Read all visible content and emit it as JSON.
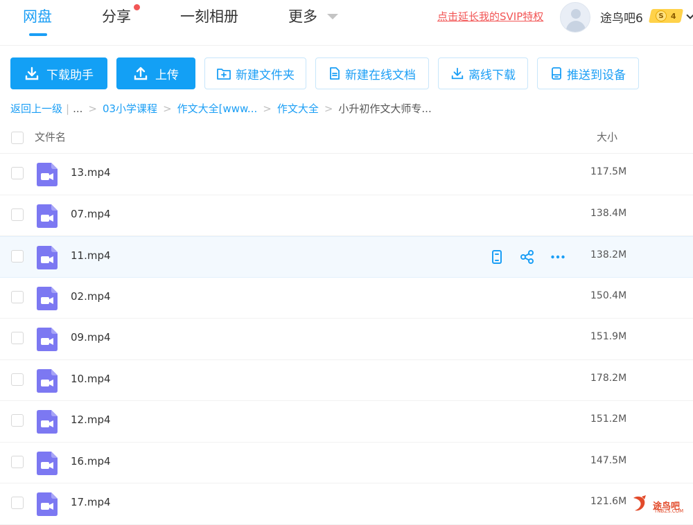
{
  "nav": {
    "items": [
      {
        "label": "网盘",
        "active": true
      },
      {
        "label": "分享"
      },
      {
        "label": "一刻相册"
      },
      {
        "label": "更多"
      }
    ],
    "accent": "#1a9ef5",
    "svip_link": "点击延长我的SVIP特权",
    "username": "途鸟吧6",
    "vip_level": "4",
    "vip_letter": "S"
  },
  "toolbar": {
    "download_helper": "下载助手",
    "upload": "上传",
    "new_folder": "新建文件夹",
    "new_online_doc": "新建在线文档",
    "offline_download": "离线下载",
    "push_to_device": "推送到设备"
  },
  "breadcrumb": {
    "back": "返回上一级",
    "ellipsis": "...",
    "items": [
      "03小学课程",
      "作文大全[www...",
      "作文大全"
    ],
    "current": "小升初作文大师专..."
  },
  "table": {
    "col_name": "文件名",
    "col_size": "大小",
    "rows": [
      {
        "name": "13.mp4",
        "size": "117.5M"
      },
      {
        "name": "07.mp4",
        "size": "138.4M"
      },
      {
        "name": "11.mp4",
        "size": "138.2M",
        "hover": true
      },
      {
        "name": "02.mp4",
        "size": "150.4M"
      },
      {
        "name": "09.mp4",
        "size": "151.9M"
      },
      {
        "name": "10.mp4",
        "size": "178.2M"
      },
      {
        "name": "12.mp4",
        "size": "151.2M"
      },
      {
        "name": "16.mp4",
        "size": "147.5M"
      },
      {
        "name": "17.mp4",
        "size": "121.6M"
      }
    ]
  },
  "watermark": {
    "text": "途鸟吧",
    "sub": "TNBZS.COM"
  }
}
